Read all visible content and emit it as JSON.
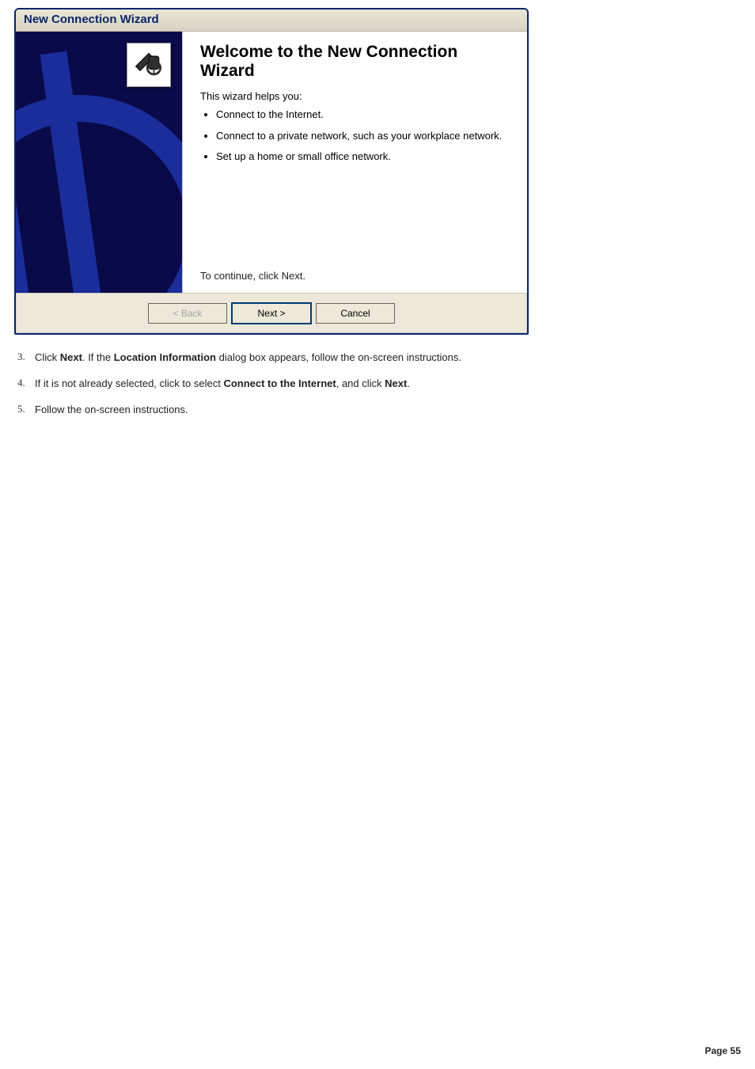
{
  "wizard": {
    "title": "New Connection Wizard",
    "heading": "Welcome to the New Connection Wizard",
    "intro": "This wizard helps you:",
    "bullets": [
      "Connect to the Internet.",
      "Connect to a private network, such as your workplace network.",
      "Set up a home or small office network."
    ],
    "continue_hint": "To continue, click Next.",
    "buttons": {
      "back": "< Back",
      "next": "Next >",
      "cancel": "Cancel"
    },
    "sidebar_icon": "network-connection-icon"
  },
  "instructions": {
    "items": [
      {
        "num": "3.",
        "prefix": "Click ",
        "bold1": "Next",
        "mid1": ". If the ",
        "bold2": "Location Information",
        "tail": " dialog box appears, follow the on-screen instructions."
      },
      {
        "num": "4.",
        "prefix": "If it is not already selected, click to select ",
        "bold1": "Connect to the Internet",
        "mid1": ", and click ",
        "bold2": "Next",
        "tail": "."
      },
      {
        "num": "5.",
        "prefix": "Follow the on-screen instructions.",
        "bold1": "",
        "mid1": "",
        "bold2": "",
        "tail": ""
      }
    ]
  },
  "page_footer": "Page 55"
}
